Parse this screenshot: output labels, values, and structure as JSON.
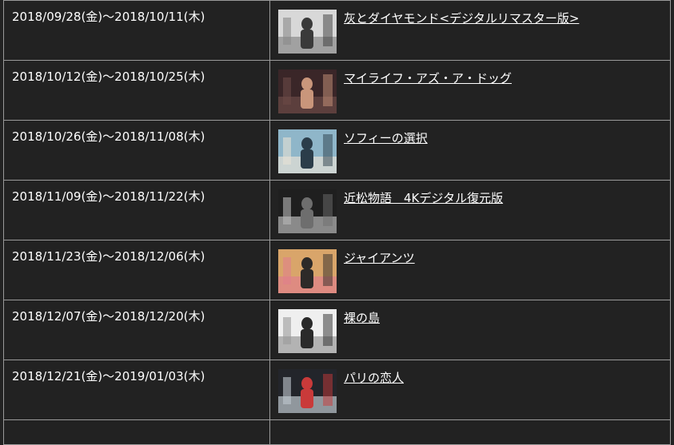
{
  "rows": [
    {
      "period": "2018/09/28(金)～2018/10/11(木)",
      "title": "灰とダイヤモンド<デジタルリマスター版>",
      "thumbnail_icon": "film-still-thumbnail",
      "palette": [
        "#d8d8d8",
        "#3a3a3a",
        "#8a8a8a"
      ]
    },
    {
      "period": "2018/10/12(金)～2018/10/25(木)",
      "title": "マイライフ・アズ・ア・ドッグ",
      "thumbnail_icon": "film-still-thumbnail",
      "palette": [
        "#3a2628",
        "#c9967b",
        "#6b4a46"
      ]
    },
    {
      "period": "2018/10/26(金)～2018/11/08(木)",
      "title": "ソフィーの選択",
      "thumbnail_icon": "film-still-thumbnail",
      "palette": [
        "#8fb6c9",
        "#2b3d4a",
        "#e6e1d6"
      ]
    },
    {
      "period": "2018/11/09(金)～2018/11/22(木)",
      "title": "近松物語　4Kデジタル復元版",
      "thumbnail_icon": "film-still-thumbnail",
      "palette": [
        "#1f1f1f",
        "#6e6e6e",
        "#b8b8b8"
      ]
    },
    {
      "period": "2018/11/23(金)～2018/12/06(木)",
      "title": "ジャイアンツ",
      "thumbnail_icon": "film-still-thumbnail",
      "palette": [
        "#d9a56a",
        "#2d2a28",
        "#e0808c"
      ]
    },
    {
      "period": "2018/12/07(金)～2018/12/20(木)",
      "title": "裸の島",
      "thumbnail_icon": "film-still-thumbnail",
      "palette": [
        "#efefef",
        "#2a2a2a",
        "#9a9a9a"
      ]
    },
    {
      "period": "2018/12/21(金)～2019/01/03(木)",
      "title": "パリの恋人",
      "thumbnail_icon": "film-still-thumbnail",
      "palette": [
        "#23252b",
        "#c93a3a",
        "#bfc8cf"
      ]
    }
  ],
  "colors": {
    "background": "#222222",
    "border": "#9a9a9a",
    "text": "#ffffff"
  }
}
